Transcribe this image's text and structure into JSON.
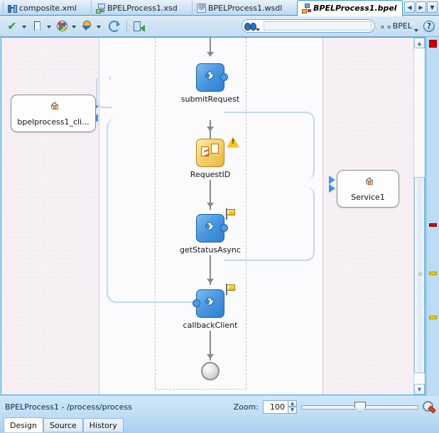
{
  "window": {
    "tabs": [
      {
        "label": "composite.xml",
        "icon": "composite-icon",
        "active": false
      },
      {
        "label": "BPELProcess1.xsd",
        "icon": "xsd-icon",
        "active": false
      },
      {
        "label": "BPELProcess1.wsdl",
        "icon": "wsdl-icon",
        "active": false
      },
      {
        "label": "BPELProcess1.bpel",
        "icon": "bpel-icon",
        "active": true
      }
    ],
    "tab_nav": [
      {
        "name": "previous-tab-button",
        "glyph": "◀"
      },
      {
        "name": "next-tab-button",
        "glyph": "▶"
      },
      {
        "name": "tab-list-button",
        "glyph": "▼"
      }
    ]
  },
  "toolbar": {
    "buttons": [
      {
        "name": "validate-button",
        "icon": "green-check-icon",
        "dropdown": true
      },
      {
        "name": "bookmark-button",
        "icon": "bookmark-icon",
        "dropdown": true
      },
      {
        "name": "palette-button",
        "icon": "color-palette-icon",
        "dropdown": true
      },
      {
        "name": "deploy-button",
        "icon": "deploy-icon",
        "dropdown": true
      },
      {
        "name": "refresh-button",
        "icon": "refresh-icon",
        "dropdown": false
      },
      {
        "name": "validate-xml-button",
        "icon": "validate-xml-icon",
        "dropdown": false
      }
    ],
    "search": {
      "placeholder": "",
      "value": "",
      "icon": "binoculars-icon"
    },
    "bpel_menu_label": "BPEL",
    "bpel_menu_icon": "glasses-icon",
    "help_label": "?"
  },
  "diagram": {
    "partner_links": [
      {
        "name": "client-partner-link",
        "label": "bpelprocess1_cli...",
        "icon": "partnerlink-gear-icon"
      },
      {
        "name": "service1-partner-link",
        "label": "Service1",
        "icon": "partnerlink-gear-icon"
      }
    ],
    "activities": [
      {
        "name": "activity-submitrequest",
        "label": "submitRequest",
        "type": "receive",
        "marker": "none"
      },
      {
        "name": "activity-requestid",
        "label": "RequestID",
        "type": "assign",
        "marker": "warning"
      },
      {
        "name": "activity-getstatusasync",
        "label": "getStatusAsync",
        "type": "invoke",
        "marker": "flag"
      },
      {
        "name": "activity-callbackclient",
        "label": "callbackClient",
        "type": "invoke",
        "marker": "flag"
      }
    ],
    "end_node": {
      "name": "process-end-node",
      "label": ""
    }
  },
  "ruler": {
    "markers": [
      {
        "name": "ruler-marker-error",
        "color": "#d00000",
        "kind": "error"
      },
      {
        "name": "ruler-marker-error",
        "color": "#d00000",
        "kind": "error"
      },
      {
        "name": "ruler-marker-warning",
        "color": "#f0d000",
        "kind": "warning"
      },
      {
        "name": "ruler-marker-warning",
        "color": "#f0d000",
        "kind": "warning"
      }
    ]
  },
  "scrollbar": {
    "up_glyph": "▲",
    "down_glyph": "▼"
  },
  "status": {
    "path": "BPELProcess1 - /process/process",
    "zoom_label": "Zoom:",
    "zoom_value": "100",
    "zoom_icon": "zoom-magnifier-icon",
    "spin_up": "▲",
    "spin_down": "▼"
  },
  "editor_tabs": [
    {
      "label": "Design",
      "selected": true
    },
    {
      "label": "Source",
      "selected": false
    },
    {
      "label": "History",
      "selected": false
    }
  ],
  "colors": {
    "accent": "#2ea7e8",
    "invoke_fill": "#4a97e0",
    "assign_fill": "#f7cf6a",
    "message_link": "#c3d5f2",
    "arrow_blue": "#3d95e8",
    "error": "#d00000",
    "warning": "#f0d000"
  }
}
